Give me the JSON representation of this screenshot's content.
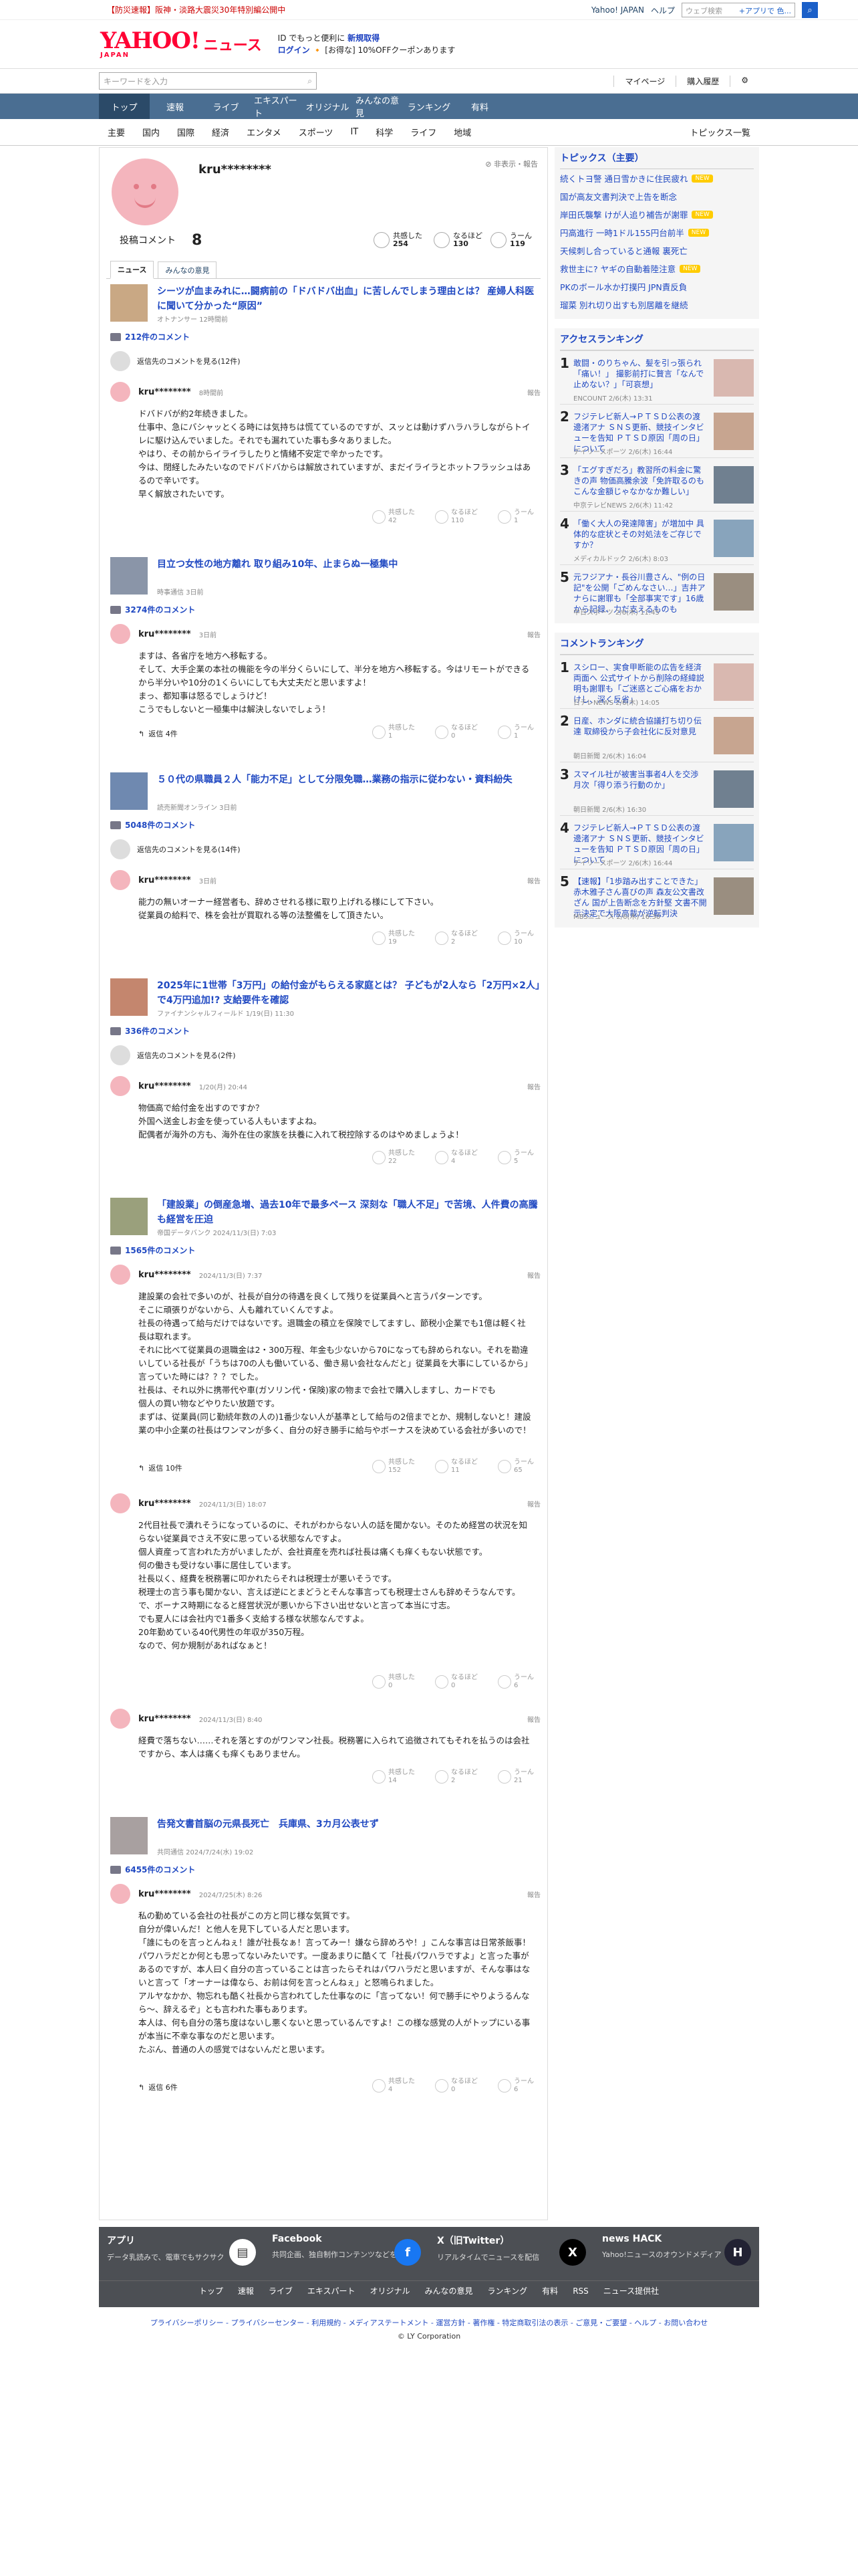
{
  "topstrip": {
    "notice": "【防災速報】阪神・淡路大震災30年特別編公開中",
    "links": [
      "Yahoo! JAPAN",
      "ヘルプ"
    ],
    "search_placeholder": "ウェブ検索",
    "search_hint": "+アプリで 色..."
  },
  "header": {
    "logo": "YAHOO!",
    "logo_sub": "JAPAN",
    "section": "ニュース",
    "promo1": "ID でもっと便利に",
    "promo1b": "新規取得",
    "promo2": "ログイン",
    "promo2b": "[お得な] 10%OFFクーポンあります"
  },
  "search": {
    "placeholder": "キーワードを入力",
    "links": [
      "マイページ",
      "購入履歴"
    ]
  },
  "gnav": [
    "トップ",
    "速報",
    "ライブ",
    "エキスパート",
    "オリジナル",
    "みんなの意見",
    "ランキング",
    "有料"
  ],
  "snav": [
    "主要",
    "国内",
    "国際",
    "経済",
    "エンタメ",
    "スポーツ",
    "IT",
    "科学",
    "ライフ",
    "地域"
  ],
  "snav_right": "トピックス一覧",
  "profile": {
    "name": "kru********",
    "hide": "非表示・報告",
    "stat_label": "投稿コメント",
    "stat_count": "8",
    "reactions": [
      {
        "label": "共感した",
        "count": "254"
      },
      {
        "label": "なるほど",
        "count": "130"
      },
      {
        "label": "うーん",
        "count": "119"
      }
    ]
  },
  "tabs": [
    "ニュース",
    "みんなの意見"
  ],
  "articles": [
    {
      "title": "シーツが血まみれに…闘病前の「ドバドバ出血」に苦しんでしまう理由とは？ 産婦人科医に聞いて分かった“原因”",
      "source": "オトナンサー 12時間前",
      "count": "212件のコメント",
      "more": "返信先のコメントを見る(12件)",
      "comments": [
        {
          "user": "kru********",
          "time": "8時間前",
          "report": "報告",
          "body": "ドバドバが約2年続きました。\n仕事中、急にバシャッとくる時には気持ちは慌てているのですが、スッとは動けずハラハラしながらトイレに駆け込んでいました。それでも漏れていた事も多々ありました。\nやはり、その前からイライラしたりと情緒不安定で辛かったです。\n今は、閉経したみたいなのでドバドバからは解放されていますが、まだイライラとホットフラッシュはあるので辛いです。\n早く解放されたいです。",
          "replies": "",
          "r": [
            "42",
            "110",
            "1"
          ]
        }
      ]
    },
    {
      "title": "目立つ女性の地方離れ 取り組み10年、止まらぬ一極集中",
      "source": "時事通信 3日前",
      "count": "3274件のコメント",
      "more": "",
      "comments": [
        {
          "user": "kru********",
          "time": "3日前",
          "report": "報告",
          "body": "ますは、各省庁を地方へ移転する。\nそして、大手企業の本社の機能を今の半分くらいにして、半分を地方へ移転する。今はリモートができるから半分いや10分の1くらいにしても大丈夫だと思いますよ！\nまっ、都知事は怒るでしょうけど！\nこうでもしないと一極集中は解決しないでしょう！",
          "replies": "返信 4件",
          "r": [
            "1",
            "0",
            "1"
          ]
        }
      ]
    },
    {
      "title": "５０代の県職員２人「能力不足」として分限免職…業務の指示に従わない・資料紛失",
      "source": "読売新聞オンライン 3日前",
      "count": "5048件のコメント",
      "more": "返信先のコメントを見る(14件)",
      "comments": [
        {
          "user": "kru********",
          "time": "3日前",
          "report": "報告",
          "body": "能力の無いオーナー経営者も、辞めさせれる様に取り上げれる様にして下さい。\n従業員の給料で、株を会社が買取れる等の法整備をして頂きたい。",
          "replies": "",
          "r": [
            "19",
            "2",
            "10"
          ]
        }
      ]
    },
    {
      "title": "2025年に1世帯「3万円」の給付金がもらえる家庭とは？ 子どもが2人なら「2万円×2人」で4万円追加!? 支給要件を確認",
      "source": "ファイナンシャルフィールド 1/19(日) 11:30",
      "count": "336件のコメント",
      "more": "返信先のコメントを見る(2件)",
      "comments": [
        {
          "user": "kru********",
          "time": "1/20(月) 20:44",
          "report": "報告",
          "body": "物価高で給付金を出すのですか？\n外国へ送金しお金を使っている人もいますよね。\n配偶者が海外の方も、海外在住の家族を扶養に入れて税控除するのはやめましょうよ！",
          "replies": "",
          "r": [
            "22",
            "4",
            "5"
          ]
        }
      ]
    },
    {
      "title": "「建設業」の倒産急増、過去10年で最多ペース 深刻な「職人不足」で苦境、人件費の高騰も経営を圧迫",
      "source": "帝国データバンク 2024/11/3(日) 7:03",
      "count": "1565件のコメント",
      "more": "",
      "comments": [
        {
          "user": "kru********",
          "time": "2024/11/3(日) 7:37",
          "report": "報告",
          "body": "建設業の会社で多いのが、社長が自分の待遇を良くして残りを従業員へと言うパターンです。\nそこに頑張りがないから、人も離れていくんですよ。\n社長の待遇って給与だけではないです。退職金の積立を保険でしてますし、節税小企業でも1億は軽く社長は取れます。\nそれに比べて従業員の退職金は2・300万程、年金も少ないから70になっても辞められない。それを勘違いしている社長が「うちは70の人も働いている、働き易い会社なんだと」従業員を大事にしているから」言っていた時には？？？でした。\n社長は、それ以外に携帯代や車(ガソリン代・保険)家の物まで会社で購入しますし、カードでも\n個人の買い物などやりたい放題です。\nまずは、従業員(同じ勤続年数の人の)1番少ない人が基準として給与の2倍までとか、規制しないと！建設業の中小企業の社長はワンマンが多く、自分の好き勝手に給与やボーナスを決めている会社が多いので！",
          "replies": "返信 10件",
          "r": [
            "152",
            "11",
            "65"
          ]
        },
        {
          "user": "kru********",
          "time": "2024/11/3(日) 18:07",
          "report": "報告",
          "body": "2代目社長で潰れそうになっているのに、それがわからない人の話を聞かない。そのため経営の状況を知らない従業員でさえ不安に思っている状態なんですよ。\n個人資産って言われた方がいましたが、会社資産を売れば社長は痛くも痒くもない状態です。\n何の働きも受けない事に居住しています。\n社長以く、経費を税務署に叩かれたらそれは税理士が悪いそうです。\n税理士の言う事も聞かない、言えば逆にとまどうとそんな事言っても税理士さんも辞めそうなんです。\nで、ボーナス時期になると経営状況が悪いから下さい出せないと言って本当に寸志。\nでも夏人には会社内で1番多く支給する様な状態なんですよ。\n20年勤めている40代男性の年収が350万程。\nなので、何か規制があればなぁと！",
          "replies": "",
          "r": [
            "0",
            "0",
            "6"
          ]
        },
        {
          "user": "kru********",
          "time": "2024/11/3(日) 8:40",
          "report": "報告",
          "body": "経費で落ちない……それを落とすのがワンマン社長。税務署に入られて追徴されてもそれを払うのは会社ですから、本人は痛くも痒くもありません。",
          "replies": "",
          "r": [
            "14",
            "2",
            "21"
          ]
        }
      ]
    },
    {
      "title": "告発文書首脳の元県長死亡　兵庫県、3カ月公表せず",
      "source": "共同通信 2024/7/24(水) 19:02",
      "count": "6455件のコメント",
      "more": "",
      "comments": [
        {
          "user": "kru********",
          "time": "2024/7/25(木) 8:26",
          "report": "報告",
          "body": "私の勤めている会社の社長がこの方と同じ様な気質です。\n自分が偉いんだ！と他人を見下している人だと思います。\n「誰にものを言っとんねぇ！誰が社長なぁ！言ってみー！嫌なら辞めろや！」こんな事言は日常茶飯事！パワハラだとか何とも思ってないみたいです。一度あまりに酷くて「社長パワハラですよ」と言った事があるのですが、本人曰く自分の言っていることは言ったらそれはパワハラだと思いますが、そんな事はないと言って「オーナーは偉なら、お前は何を言っとんねぇ」と怒鳴られました。\nアルヤなかか、物忘れも酷く社長から言われてした仕事なのに「言ってない！何で勝手にやりようるんなら～、辞えるぞ」とも言われた事もあります。\n本人は、何も自分の落ち度はないし悪くないと思っているんですよ！この様な感覚の人がトップにいる事が本当に不幸な事なのだと思います。\nたぶん、普通の人の感覚ではないんだと思います。",
          "replies": "返信 6件",
          "r": [
            "4",
            "0",
            "6"
          ]
        }
      ]
    }
  ],
  "side": {
    "topics_title": "トピックス（主要）",
    "topics": [
      {
        "t": "続くトヨ警 通日雪かきに住民疲れ",
        "b": "NEW"
      },
      {
        "t": "国が高友文書判決で上告を断念",
        "b": ""
      },
      {
        "t": "岸田氏襲撃 けが人追り補告が謝罪",
        "b": "NEW"
      },
      {
        "t": "円高進行 一時1ドル155円台前半",
        "b": "NEW"
      },
      {
        "t": "天候刺し合っていると通報 裏死亡",
        "b": ""
      },
      {
        "t": "救世主に? ヤギの自動着陸注意",
        "b": "NEW"
      },
      {
        "t": "PKのボール水か打撲円 JPN責反負",
        "b": ""
      },
      {
        "t": "瑠菜 別れ切り出すも別居離を継続",
        "b": ""
      }
    ],
    "access_title": "アクセスランキング",
    "access": [
      {
        "n": "1",
        "t": "敢闘・のりちゃん、髪を引っ張られ「痛い！」 撮影前打に贅言「なんで止めない？」「可哀想」",
        "m": "ENCOUNT 2/6(木) 13:31"
      },
      {
        "n": "2",
        "t": "フジテレビ新人→ＰＴＳＤ公表の渡邊渚アナ ＳＮＳ更新、競技インタビューを告知 ＰＴＳＤ原因「周の日」について",
        "m": "デイリースポーツ 2/6(木) 16:44"
      },
      {
        "n": "3",
        "t": "「エグすぎだろ」教習所の料金に驚きの声 物価高騰余波「免許取るのもこんな金額じゃなかなか難しい」",
        "m": "中京テレビNEWS 2/6(木) 11:42"
      },
      {
        "n": "4",
        "t": "「働く大人の発達障害」が増加中 具体的な症状とその対処法をご存じですか？",
        "m": "メディカルドック 2/6(木) 8:03"
      },
      {
        "n": "5",
        "t": "元フジアナ・長谷川豊さん、\"例の日記\"を公開「ごめんなさい…」吉井アナらに謝罪も「全部事実です」16歳から記録、力だ支えるものも",
        "m": "中日スポーツ 2/6(木) 11:45"
      }
    ],
    "comment_title": "コメントランキング",
    "crank": [
      {
        "n": "1",
        "t": "スシロー、実食甲断能の広告を経済両面へ 公式サイトから削除の経緯説明も謝罪も「ご迷惑とご心痛をおかけし、深く反省」",
        "m": "日テレNEWS 2/6(木) 14:05"
      },
      {
        "n": "2",
        "t": "日産、ホンダに統合協議打ち切り伝達 取締役から子会社化に反対意見",
        "m": "朝日新聞 2/6(木) 16:04"
      },
      {
        "n": "3",
        "t": "スマイル社が被害当事者4人を交渉 月次「得り添う行動のか」",
        "m": "朝日新聞 2/6(木) 16:30"
      },
      {
        "n": "4",
        "t": "フジテレビ新人→ＰＴＳＤ公表の渡邊渚アナ ＳＮＳ更新、競技インタビューを告知 ＰＴＳＤ原因「周の日」について",
        "m": "デイリースポーツ 2/6(木) 16:44"
      },
      {
        "n": "5",
        "t": "【速報】「1歩踏み出すことできた」赤木雅子さん喜びの声 森友公文書改ざん 国が上告断念を方針堅 文書不開示決定で大阪高裁が逆転判決",
        "m": "MBSニュース 2/6(木) 16:30"
      }
    ]
  },
  "footer": {
    "blocks": [
      {
        "t": "アプリ",
        "s": "データ乳読みで、電車でもサクサク",
        "i": "▤"
      },
      {
        "t": "Facebook",
        "s": "共同企画、独自制作コンテンツなどを投稿",
        "i": "f"
      },
      {
        "t": "X（旧Twitter）",
        "s": "リアルタイムでニュースを配信",
        "i": "X"
      },
      {
        "t": "news HACK",
        "s": "Yahoo!ニュースのオウンドメディア",
        "i": "H"
      }
    ],
    "nav": [
      "トップ",
      "速報",
      "ライブ",
      "エキスパート",
      "オリジナル",
      "みんなの意見",
      "ランキング",
      "有料",
      "RSS",
      "ニュース提供社"
    ],
    "links": "プライバシーポリシー - プライバシーセンター - 利用規約 - メディアステートメント - 運営方針 - 著作権 - 特定商取引法の表示 - ご意見・ご要望 - ヘルプ - お問い合わせ",
    "copy": "© LY Corporation"
  }
}
